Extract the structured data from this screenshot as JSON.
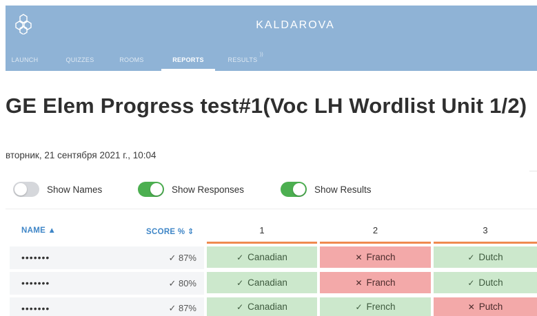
{
  "app": {
    "brand": "KALDAROVA",
    "logo_icon": "hexagon-cluster-icon"
  },
  "nav": [
    {
      "label": "LAUNCH",
      "active": false
    },
    {
      "label": "QUIZZES",
      "active": false
    },
    {
      "label": "ROOMS",
      "active": false
    },
    {
      "label": "REPORTS",
      "active": true
    },
    {
      "label": "RESULTS",
      "active": false,
      "icon": "wifi-icon"
    }
  ],
  "report": {
    "title": "GE Elem Progress test#1(Voc LH Wordlist Unit 1/2)",
    "date": "вторник, 21 сентября 2021 г., 10:04"
  },
  "toggles": [
    {
      "label": "Show Names",
      "on": false
    },
    {
      "label": "Show Responses",
      "on": true
    },
    {
      "label": "Show Results",
      "on": true
    }
  ],
  "table": {
    "columns": {
      "name": "NAME ▲",
      "score": "SCORE % ⇕",
      "questions": [
        "1",
        "2",
        "3"
      ]
    },
    "rows": [
      {
        "name": "•••••••",
        "score": "87%",
        "answers": [
          {
            "text": "Canadian",
            "correct": true
          },
          {
            "text": "Franch",
            "correct": false
          },
          {
            "text": "Dutch",
            "correct": true
          }
        ]
      },
      {
        "name": "•••••••",
        "score": "80%",
        "answers": [
          {
            "text": "Canadian",
            "correct": true
          },
          {
            "text": "Franch",
            "correct": false
          },
          {
            "text": "Dutch",
            "correct": true
          }
        ]
      },
      {
        "name": "•••••••",
        "score": "87%",
        "answers": [
          {
            "text": "Canadian",
            "correct": true
          },
          {
            "text": "French",
            "correct": true
          },
          {
            "text": "Putch",
            "correct": false
          }
        ]
      }
    ]
  },
  "colors": {
    "header_bg": "#8fb3d6",
    "accent_blue": "#3f86c7",
    "toggle_on": "#4caf50",
    "correct_bg": "#cce8cc",
    "incorrect_bg": "#f3a9a9",
    "question_bar": "#ef8a4f"
  }
}
